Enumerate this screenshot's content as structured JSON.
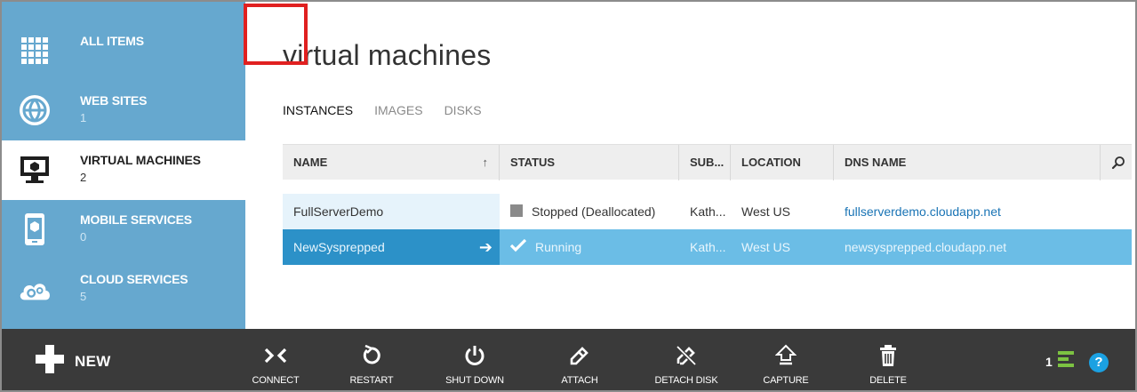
{
  "sidebar": {
    "items": [
      {
        "label": "ALL ITEMS",
        "count": "",
        "icon": "grid-icon"
      },
      {
        "label": "WEB SITES",
        "count": "1",
        "icon": "globe-icon"
      },
      {
        "label": "VIRTUAL MACHINES",
        "count": "2",
        "icon": "monitor-icon",
        "selected": true
      },
      {
        "label": "MOBILE SERVICES",
        "count": "0",
        "icon": "phone-icon"
      },
      {
        "label": "CLOUD SERVICES",
        "count": "5",
        "icon": "cloud-gear-icon"
      }
    ]
  },
  "main": {
    "title": "virtual machines",
    "tabs": [
      {
        "label": "INSTANCES",
        "active": true
      },
      {
        "label": "IMAGES"
      },
      {
        "label": "DISKS"
      }
    ],
    "columns": [
      "NAME",
      "STATUS",
      "SUB...",
      "LOCATION",
      "DNS NAME"
    ],
    "sort_indicator": "↑",
    "rows": [
      {
        "name": "FullServerDemo",
        "status": "Stopped (Deallocated)",
        "subscription": "Kath...",
        "location": "West US",
        "dns": "fullserverdemo.cloudapp.net",
        "selected": false
      },
      {
        "name": "NewSysprepped",
        "status": "Running",
        "subscription": "Kath...",
        "location": "West US",
        "dns": "newsysprepped.cloudapp.net",
        "selected": true
      }
    ]
  },
  "commandbar": {
    "new_label": "NEW",
    "commands": [
      {
        "label": "CONNECT",
        "icon": "connect-icon"
      },
      {
        "label": "RESTART",
        "icon": "restart-icon"
      },
      {
        "label": "SHUT DOWN",
        "icon": "power-icon"
      },
      {
        "label": "ATTACH",
        "icon": "link-icon"
      },
      {
        "label": "DETACH DISK",
        "icon": "broken-link-icon"
      },
      {
        "label": "CAPTURE",
        "icon": "capture-icon"
      },
      {
        "label": "DELETE",
        "icon": "trash-icon"
      }
    ],
    "activity_count": "1",
    "help_label": "?"
  },
  "colors": {
    "sidebar_bg": "#66a8cf",
    "selected_row": "#6bbde6",
    "selected_name_cell": "#2c91c8",
    "command_bar": "#3a3a3a",
    "highlight_box": "#e02020",
    "activity_green": "#7cc242",
    "help_blue": "#1ba1e2"
  }
}
